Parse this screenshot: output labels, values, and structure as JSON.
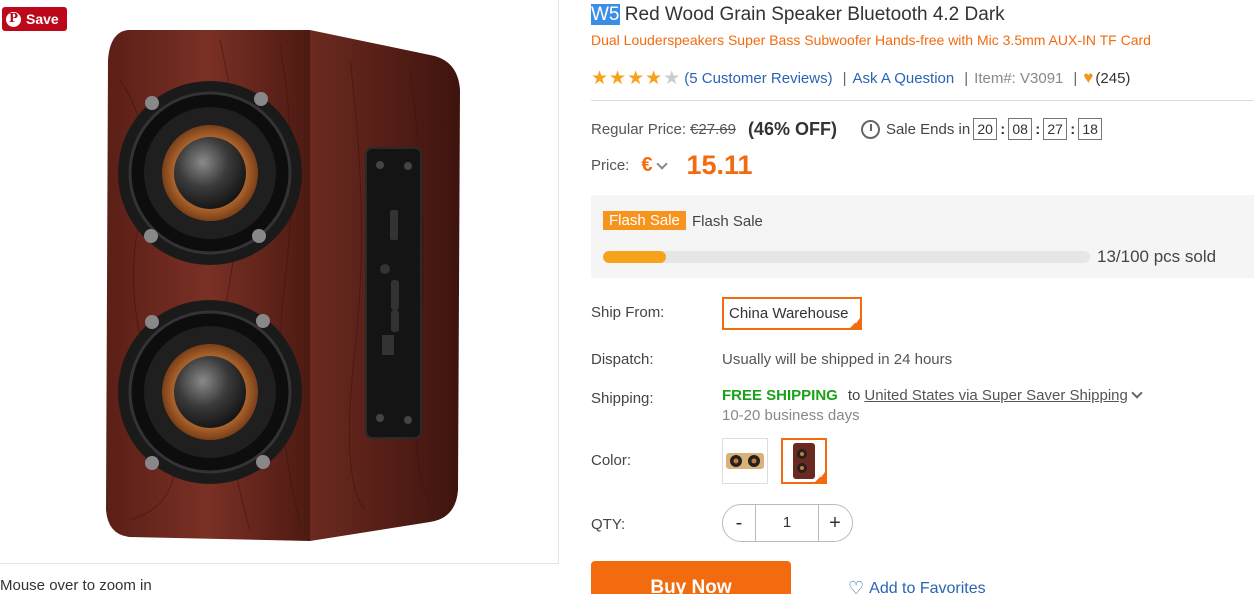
{
  "pinterest": {
    "save_label": "Save"
  },
  "image_panel": {
    "zoom_hint": "Mouse over to zoom in"
  },
  "product": {
    "title_highlight": "W5",
    "title_rest": " Red Wood Grain Speaker Bluetooth 4.2 Dark",
    "subtitle": "Dual Louderspeakers Super Bass Subwoofer Hands-free with Mic 3.5mm AUX-IN TF Card",
    "rating": {
      "stars_filled": 4,
      "stars_total": 5
    },
    "reviews_link": "(5 Customer Reviews)",
    "sep1": "|",
    "ask_question": "Ask A Question",
    "sep2": "|",
    "item_no": "Item#: V3091",
    "sep3": "|",
    "favorites_count": "(245)"
  },
  "pricing": {
    "regular_label": "Regular Price:",
    "regular_price": "€27.69",
    "discount": "(46% OFF)",
    "sale_ends_label": "Sale Ends in",
    "countdown": [
      "20",
      "08",
      "27",
      "18"
    ],
    "price_label": "Price:",
    "currency_symbol": "€",
    "price": "15.11"
  },
  "flash_sale": {
    "tag": "Flash Sale",
    "text": "Flash Sale",
    "sold_text": "13/100 pcs sold",
    "sold_fraction": 0.13
  },
  "options": {
    "ship_from_label": "Ship From:",
    "ship_from_value": "China Warehouse",
    "dispatch_label": "Dispatch:",
    "dispatch_value": "Usually will be shipped in 24 hours",
    "shipping_label": "Shipping:",
    "shipping_free": "FREE SHIPPING",
    "shipping_to": "to",
    "shipping_dest": "United States via Super Saver Shipping",
    "shipping_days": "10-20 business days",
    "color_label": "Color:",
    "qty_label": "QTY:",
    "qty_minus": "-",
    "qty_value": "1",
    "qty_plus": "+"
  },
  "actions": {
    "buy_now": "Buy Now",
    "add_favorites": "Add to Favorites"
  },
  "colors": {
    "accent": "#f26b0f",
    "pinterest": "#bd081c",
    "link": "#2a64b4",
    "free_shipping": "#1aa11a",
    "star": "#f7a21b"
  }
}
